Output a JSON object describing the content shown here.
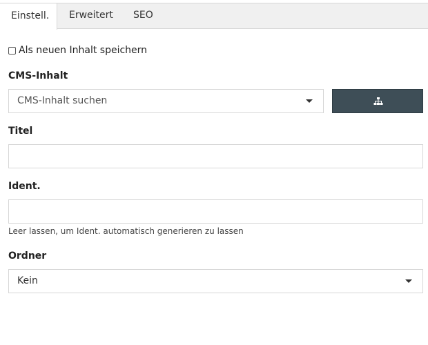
{
  "tabs": [
    {
      "label": "Einstell.",
      "active": true
    },
    {
      "label": "Erweitert",
      "active": false
    },
    {
      "label": "SEO",
      "active": false
    }
  ],
  "save_as_new": {
    "label": "Als neuen Inhalt speichern",
    "checked": false
  },
  "cms_content": {
    "label": "CMS-Inhalt",
    "placeholder": "CMS-Inhalt suchen",
    "tree_button_icon": "sitemap-icon"
  },
  "title": {
    "label": "Titel",
    "value": ""
  },
  "ident": {
    "label": "Ident.",
    "value": "",
    "help": "Leer lassen, um Ident. automatisch generieren zu lassen"
  },
  "folder": {
    "label": "Ordner",
    "value": "Kein"
  },
  "colors": {
    "tree_button_bg": "#3e4e57",
    "tab_bar_bg": "#f0f0f0",
    "border": "#d6d6d6"
  }
}
